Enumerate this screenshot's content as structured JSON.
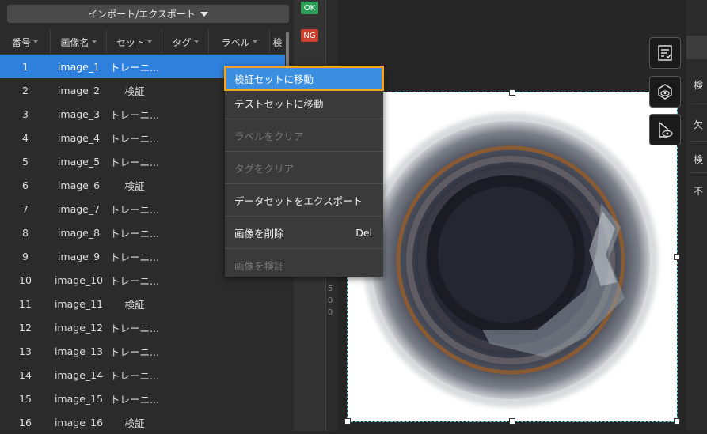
{
  "toolbar": {
    "import_export_label": "インポート/エクスポート"
  },
  "table": {
    "headers": [
      "番号",
      "画像名",
      "セット",
      "タグ",
      "ラベル",
      "検"
    ],
    "rows": [
      {
        "no": "1",
        "name": "image_1",
        "set": "トレーニ..."
      },
      {
        "no": "2",
        "name": "image_2",
        "set": "検証"
      },
      {
        "no": "3",
        "name": "image_3",
        "set": "トレーニ..."
      },
      {
        "no": "4",
        "name": "image_4",
        "set": "トレーニ..."
      },
      {
        "no": "5",
        "name": "image_5",
        "set": "トレーニ..."
      },
      {
        "no": "6",
        "name": "image_6",
        "set": "検証"
      },
      {
        "no": "7",
        "name": "image_7",
        "set": "トレーニ..."
      },
      {
        "no": "8",
        "name": "image_8",
        "set": "トレーニ..."
      },
      {
        "no": "9",
        "name": "image_9",
        "set": "トレーニ..."
      },
      {
        "no": "10",
        "name": "image_10",
        "set": "トレーニ..."
      },
      {
        "no": "11",
        "name": "image_11",
        "set": "検証"
      },
      {
        "no": "12",
        "name": "image_12",
        "set": "トレーニ..."
      },
      {
        "no": "13",
        "name": "image_13",
        "set": "トレーニ..."
      },
      {
        "no": "14",
        "name": "image_14",
        "set": "トレーニ..."
      },
      {
        "no": "15",
        "name": "image_15",
        "set": "トレーニ..."
      },
      {
        "no": "16",
        "name": "image_16",
        "set": "検証"
      }
    ],
    "selected_row": "1"
  },
  "badges": {
    "ok": "OK",
    "ng": "NG",
    "ok_color": "#2e9e5b",
    "ng_color": "#c9402f"
  },
  "ruler": {
    "digits": [
      "5",
      "0",
      "0"
    ]
  },
  "context_menu": {
    "move_to_validation": "検証セットに移動",
    "move_to_test": "テストセットに移動",
    "clear_labels": "ラベルをクリア",
    "clear_tags": "タグをクリア",
    "export_dataset": "データセットをエクスポート",
    "delete_image": "画像を削除",
    "delete_shortcut": "Del",
    "validate_image": "画像を検証"
  },
  "right_panel": {
    "items": [
      "検",
      "欠",
      "検",
      "不"
    ]
  },
  "colors": {
    "selection": "#2f80dc",
    "menu_highlight": "#3c8ee0",
    "menu_focus_outline": "#f5a21c"
  }
}
